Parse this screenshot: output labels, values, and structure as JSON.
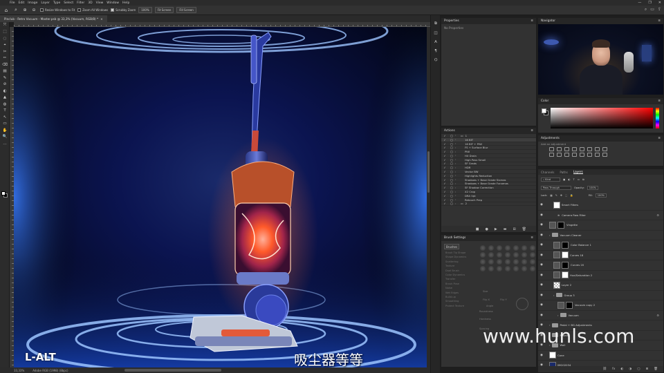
{
  "app": {
    "menu": [
      "File",
      "Edit",
      "Image",
      "Layer",
      "Type",
      "Select",
      "Filter",
      "3D",
      "View",
      "Window",
      "Help"
    ],
    "window_controls": [
      "—",
      "❐",
      "✕"
    ]
  },
  "options_bar": {
    "resize_windows": "Resize Windows to Fit",
    "zoom_all": "Zoom All Windows",
    "scrubby_zoom": "Scrubby Zoom",
    "zoom_value": "100%",
    "fit_screen": "Fit Screen",
    "fill_screen": "Fill Screen"
  },
  "document": {
    "tab_title": "Pinclub - Retro Vacuum - Master.psb @ 33,3% (Vacuum, RGB/8) *",
    "tab_close": "×",
    "status_zoom": "33,33%",
    "status_info": "Adobe RGB (1998) (8bpc)"
  },
  "overlays": {
    "key_hint": "L-ALT",
    "subtitle": "吸尘器等等",
    "watermark": "www.hunls.com"
  },
  "tools": [
    "⤧",
    "⬚",
    "◌",
    "⌖",
    "✂",
    "✏",
    "⌫",
    "▤",
    "✎",
    "⊘",
    "◐",
    "▲",
    "◍",
    "T",
    "↖",
    "▭",
    "✋",
    "🔍",
    "…"
  ],
  "side_icons": [
    "⧉",
    "◫",
    "A",
    "¶",
    "⌬"
  ],
  "properties": {
    "title": "Properties",
    "body": "No Properties"
  },
  "actions": {
    "title": "Actions",
    "items": [
      {
        "label": "1",
        "indent": 0,
        "folder": true,
        "selected": false
      },
      {
        "label": "16 BIT",
        "indent": 1,
        "folder": false,
        "selected": true
      },
      {
        "label": "16 BIT + PIW",
        "indent": 1,
        "folder": false,
        "selected": false
      },
      {
        "label": "FS + Surface Blur",
        "indent": 1,
        "folder": false,
        "selected": false
      },
      {
        "label": "PIW",
        "indent": 1,
        "folder": false,
        "selected": false
      },
      {
        "label": "HX Drain",
        "indent": 1,
        "folder": false,
        "selected": false
      },
      {
        "label": "High Pass Small",
        "indent": 1,
        "folder": false,
        "selected": false
      },
      {
        "label": "SF Grads",
        "indent": 1,
        "folder": false,
        "selected": false
      },
      {
        "label": "HDR",
        "indent": 1,
        "folder": false,
        "selected": false
      },
      {
        "label": "Vector BW",
        "indent": 1,
        "folder": false,
        "selected": false
      },
      {
        "label": "Highlights Reduction",
        "indent": 1,
        "folder": false,
        "selected": false
      },
      {
        "label": "Shadows + Base Grade Sixmas",
        "indent": 1,
        "folder": false,
        "selected": false
      },
      {
        "label": "Shadows + Base Grade Funamas",
        "indent": 1,
        "folder": false,
        "selected": false
      },
      {
        "label": "SF Shadow Correction",
        "indent": 1,
        "folder": false,
        "selected": false
      },
      {
        "label": "X2 Crop",
        "indent": 1,
        "folder": false,
        "selected": false
      },
      {
        "label": "DRA Vpt",
        "indent": 1,
        "folder": false,
        "selected": false
      },
      {
        "label": "Retouch Prep",
        "indent": 1,
        "folder": false,
        "selected": false
      },
      {
        "label": "2",
        "indent": 0,
        "folder": true,
        "selected": false
      }
    ],
    "footer_icons": [
      "■",
      "●",
      "▶",
      "▬",
      "⊞",
      "🗑"
    ]
  },
  "brush_settings": {
    "title": "Brush Settings",
    "brushes_button": "Brushes",
    "options": [
      "Brush Tip Shape",
      "Shape Dynamics",
      "Scattering",
      "Texture",
      "Dual Brush",
      "Color Dynamics",
      "Transfer",
      "Brush Pose",
      "Noise",
      "Wet Edges",
      "Build-up",
      "Smoothing",
      "Protect Texture"
    ],
    "params": {
      "size": "Size",
      "flip_x": "Flip X",
      "flip_y": "Flip Y",
      "angle": "Angle",
      "roundness": "Roundness",
      "hardness": "Hardness",
      "spacing": "Spacing"
    }
  },
  "navigator": {
    "title": "Navigator"
  },
  "color": {
    "title": "Color"
  },
  "adjustments": {
    "title": "Adjustments",
    "hint": "Add an adjustment"
  },
  "layers": {
    "tabs": [
      "Channels",
      "Paths",
      "Layers"
    ],
    "active_tab": "Layers",
    "kind": "Kind",
    "blend_mode": "Pass Through",
    "opacity_label": "Opacity:",
    "opacity_value": "100%",
    "lock_label": "Lock:",
    "fill_label": "Fill:",
    "fill_value": "100%",
    "rows": [
      {
        "name": "Smart Filters",
        "indent": 2,
        "type": "thumb-white",
        "fx": ""
      },
      {
        "name": "Camera Raw Filter",
        "indent": 3,
        "type": "effect",
        "fx": "⚙"
      },
      {
        "name": "Vingette",
        "indent": 1,
        "type": "adj-mask",
        "fx": ""
      },
      {
        "name": "Vacuum Cleaner",
        "indent": 1,
        "type": "folder",
        "fx": ""
      },
      {
        "name": "Color Balance 1",
        "indent": 2,
        "type": "adj-mask",
        "fx": ""
      },
      {
        "name": "Curves 18",
        "indent": 2,
        "type": "adj-white",
        "fx": ""
      },
      {
        "name": "Curves 20",
        "indent": 2,
        "type": "adj-mask",
        "fx": ""
      },
      {
        "name": "Hue/Saturation 2",
        "indent": 2,
        "type": "adj-white",
        "fx": ""
      },
      {
        "name": "Layer 2",
        "indent": 2,
        "type": "thumb-check",
        "fx": ""
      },
      {
        "name": "Group 3",
        "indent": 2,
        "type": "folder",
        "fx": ""
      },
      {
        "name": "Vacuum copy 2",
        "indent": 3,
        "type": "adj-mask",
        "fx": ""
      },
      {
        "name": "Vacuum",
        "indent": 3,
        "type": "folder",
        "fx": "⚙"
      },
      {
        "name": "Pedal + BG Adjustments",
        "indent": 1,
        "type": "folder",
        "fx": ""
      },
      {
        "name": "Pedals",
        "indent": 1,
        "type": "folder",
        "fx": ""
      },
      {
        "name": "Wall",
        "indent": 1,
        "type": "folder",
        "fx": ""
      },
      {
        "name": "Cone",
        "indent": 1,
        "type": "thumb-white",
        "fx": ""
      },
      {
        "name": "IMG02034",
        "indent": 1,
        "type": "thumb-dark",
        "fx": ""
      }
    ],
    "footer_icons": [
      "⛓",
      "fx",
      "◐",
      "◑",
      "▢",
      "⊞",
      "🗑"
    ]
  },
  "colors": {
    "accent": "#31a8ff",
    "canvas_glow": "#2f6bff",
    "vacuum_core": "#ff5a2a"
  }
}
